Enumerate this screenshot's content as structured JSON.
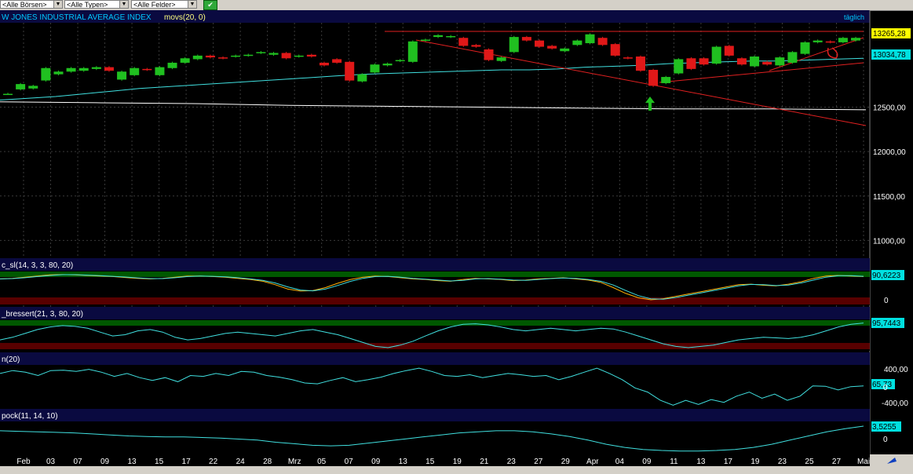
{
  "toolbar": {
    "filters": [
      "<Alle Börsen>",
      "<Alle Typen>",
      "<Alle Felder>"
    ],
    "go_icon": "check-icon"
  },
  "chart_data": [
    {
      "type": "candlestick",
      "title": "W JONES INDUSTRIAL AVERAGE INDEX",
      "indicator": "movs(20, 0)",
      "period": "täglich",
      "ylim": [
        10800,
        13450
      ],
      "yticks": [
        11000,
        11500,
        12000,
        12500
      ],
      "ytick_labels": [
        "11000,00",
        "11500,00",
        "12000,00",
        "12500,00"
      ],
      "price_label": "13265,28",
      "ma_label": "13034,78",
      "x_labels": [
        "Feb",
        "03",
        "07",
        "09",
        "13",
        "15",
        "17",
        "22",
        "24",
        "28",
        "Mrz",
        "05",
        "07",
        "09",
        "13",
        "15",
        "19",
        "21",
        "23",
        "27",
        "29",
        "Apr",
        "04",
        "09",
        "11",
        "13",
        "17",
        "19",
        "23",
        "25",
        "27",
        "Mai"
      ],
      "candles": [
        [
          12650,
          12650
        ],
        [
          12700,
          12760
        ],
        [
          12710,
          12740
        ],
        [
          12800,
          12940
        ],
        [
          12870,
          12900
        ],
        [
          12900,
          12940
        ],
        [
          12910,
          12940
        ],
        [
          12930,
          12950
        ],
        [
          12950,
          12910
        ],
        [
          12810,
          12900
        ],
        [
          12860,
          12940
        ],
        [
          12930,
          12920
        ],
        [
          12860,
          12950
        ],
        [
          12940,
          13000
        ],
        [
          13000,
          13050
        ],
        [
          13040,
          13080
        ],
        [
          13080,
          13060
        ],
        [
          13060,
          13050
        ],
        [
          13070,
          13080
        ],
        [
          13080,
          13090
        ],
        [
          13110,
          13120
        ],
        [
          13090,
          13110
        ],
        [
          13110,
          13050
        ],
        [
          13070,
          13080
        ],
        [
          13090,
          13070
        ],
        [
          13000,
          12970
        ],
        [
          13040,
          13000
        ],
        [
          13010,
          12800
        ],
        [
          12790,
          12870
        ],
        [
          12890,
          12980
        ],
        [
          12970,
          12990
        ],
        [
          13020,
          13030
        ],
        [
          13010,
          13240
        ],
        [
          13250,
          13260
        ],
        [
          13290,
          13310
        ],
        [
          13290,
          13300
        ],
        [
          13280,
          13190
        ],
        [
          13200,
          13180
        ],
        [
          13150,
          13030
        ],
        [
          13020,
          13060
        ],
        [
          13120,
          13290
        ],
        [
          13290,
          13250
        ],
        [
          13250,
          13180
        ],
        [
          13190,
          13160
        ],
        [
          13130,
          13160
        ],
        [
          13200,
          13250
        ],
        [
          13220,
          13320
        ],
        [
          13280,
          13200
        ],
        [
          13210,
          13080
        ],
        [
          13060,
          13050
        ],
        [
          13070,
          12910
        ],
        [
          12920,
          12740
        ],
        [
          12770,
          12840
        ],
        [
          12880,
          13040
        ],
        [
          13050,
          12930
        ],
        [
          13050,
          12980
        ],
        [
          12990,
          13180
        ],
        [
          13190,
          13080
        ],
        [
          13050,
          12980
        ],
        [
          12960,
          13070
        ],
        [
          13010,
          12980
        ],
        [
          12970,
          13060
        ],
        [
          13000,
          13120
        ],
        [
          13100,
          13230
        ],
        [
          13230,
          13250
        ],
        [
          13240,
          13230
        ],
        [
          13230,
          13280
        ],
        [
          13250,
          13280
        ]
      ],
      "ma20": [
        12580,
        12600,
        12620,
        12650,
        12680,
        12710,
        12730,
        12750,
        12770,
        12790,
        12810,
        12830,
        12850,
        12870,
        12880,
        12890,
        12900,
        12910,
        12920,
        12920,
        12930,
        12950,
        12960,
        12970,
        12990,
        13000,
        13010,
        13020,
        13020,
        13030,
        13040,
        13050
      ],
      "ma200": [
        12560,
        12550,
        12540,
        12520,
        12510,
        12500,
        12490,
        12480,
        12480,
        12470
      ],
      "annotations": [
        "green-up-arrow",
        "red-circle",
        "support-resistance trendlines"
      ]
    },
    {
      "type": "line",
      "title": "c_sl(14, 3, 3, 80, 20)",
      "value_label": "90,6223",
      "ytick_labels": [
        "0"
      ],
      "series": [
        {
          "values": [
            80,
            82,
            86,
            90,
            94,
            95,
            94,
            92,
            90,
            88,
            85,
            82,
            80,
            82,
            86,
            90,
            90,
            88,
            86,
            82,
            78,
            72,
            60,
            45,
            38,
            40,
            50,
            65,
            78,
            86,
            90,
            88,
            84,
            80,
            78,
            74,
            72,
            78,
            82,
            80,
            78,
            74,
            76,
            80,
            82,
            84,
            80,
            76,
            68,
            50,
            30,
            15,
            8,
            12,
            20,
            28,
            36,
            44,
            52,
            60,
            62,
            58,
            56,
            62,
            70,
            82,
            90,
            92,
            90,
            88
          ]
        }
      ]
    },
    {
      "type": "line",
      "title": "_bressert(21, 3, 80, 20)",
      "value_label": "95,7443",
      "series": [
        {
          "values": [
            30,
            40,
            55,
            70,
            80,
            85,
            82,
            75,
            60,
            45,
            50,
            65,
            70,
            60,
            40,
            30,
            35,
            45,
            55,
            60,
            55,
            50,
            45,
            55,
            65,
            70,
            60,
            50,
            35,
            20,
            5,
            0,
            10,
            25,
            45,
            65,
            80,
            90,
            92,
            88,
            80,
            70,
            65,
            70,
            75,
            70,
            65,
            70,
            75,
            72,
            60,
            45,
            30,
            15,
            5,
            0,
            5,
            10,
            20,
            30,
            35,
            40,
            38,
            35,
            40,
            50,
            65,
            80,
            90,
            95
          ]
        }
      ]
    },
    {
      "type": "line",
      "title": "n(20)",
      "value_label": "65,73",
      "ytick_labels": [
        "400,00",
        "0",
        "-400,00"
      ],
      "series": [
        {
          "values": [
            350,
            420,
            380,
            300,
            420,
            430,
            400,
            450,
            380,
            280,
            350,
            250,
            180,
            250,
            150,
            300,
            280,
            350,
            300,
            400,
            380,
            300,
            260,
            200,
            120,
            100,
            180,
            250,
            150,
            200,
            260,
            350,
            420,
            480,
            400,
            300,
            280,
            320,
            250,
            300,
            350,
            320,
            280,
            300,
            200,
            280,
            380,
            480,
            350,
            200,
            0,
            -100,
            -300,
            -420,
            -300,
            -400,
            -280,
            -350,
            -200,
            -100,
            -250,
            -150,
            -300,
            -200,
            50,
            40,
            -50,
            30,
            50
          ]
        }
      ]
    },
    {
      "type": "line",
      "title": "pock(11, 14, 10)",
      "value_label": "3,5255",
      "ytick_labels": [
        "0"
      ],
      "series": [
        {
          "values": [
            2.6,
            2.5,
            2.4,
            2.3,
            2.2,
            2.0,
            1.8,
            1.6,
            1.5,
            1.4,
            1.4,
            1.3,
            1.2,
            1.0,
            0.8,
            0.4,
            0.1,
            -0.2,
            -0.3,
            -0.2,
            0.2,
            0.6,
            1.0,
            1.4,
            1.8,
            2.2,
            2.4,
            2.6,
            2.6,
            2.4,
            2.0,
            1.5,
            0.8,
            0.0,
            -0.6,
            -1.0,
            -1.2,
            -1.3,
            -1.3,
            -1.2,
            -1.0,
            -0.6,
            0.0,
            0.8,
            1.6,
            2.4,
            3.0,
            3.5
          ]
        }
      ]
    }
  ]
}
